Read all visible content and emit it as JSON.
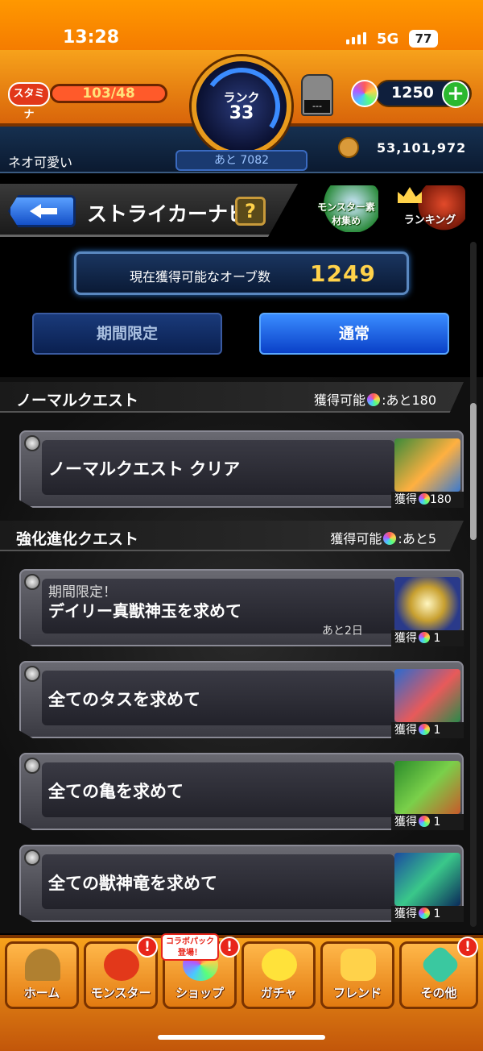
{
  "status_bar": {
    "time": "13:28",
    "network": "5G",
    "battery": "77"
  },
  "header": {
    "stamina_label": "スタミナ",
    "stamina_value": "103/48",
    "rank_label": "ランク",
    "rank_value": "33",
    "rank_remaining": "あと 7082",
    "helmet_value": "---",
    "orb_count": "1250",
    "player_name": "ネオ可愛い",
    "coins": "53,101,972"
  },
  "nav": {
    "title": "ストライカーナビ",
    "help": "?",
    "monster_collect_label": "モンスター素材集め",
    "ranking_label": "ランキング"
  },
  "orb_panel": {
    "label": "現在獲得可能なオーブ数",
    "value": "1249"
  },
  "tabs": {
    "limited": "期間限定",
    "normal": "通常"
  },
  "sections": [
    {
      "name": "ノーマルクエスト",
      "available_prefix": "獲得可能",
      "available_suffix": ":あと180"
    },
    {
      "name": "強化進化クエスト",
      "available_prefix": "獲得可能",
      "available_suffix": ":あと5"
    }
  ],
  "cards": [
    {
      "title": "ノーマルクエスト クリア",
      "reward_label": "獲得",
      "reward_value": "180"
    },
    {
      "sub": "期間限定！",
      "title": "デイリー真獣神玉を求めて",
      "days": "あと2日",
      "reward_label": "獲得",
      "reward_value": "1"
    },
    {
      "title": "全てのタスを求めて",
      "reward_label": "獲得",
      "reward_value": "1"
    },
    {
      "title": "全ての亀を求めて",
      "reward_label": "獲得",
      "reward_value": "1"
    },
    {
      "title": "全ての獣神竜を求めて",
      "reward_label": "獲得",
      "reward_value": "1"
    }
  ],
  "bottom_nav": {
    "home": "ホーム",
    "monster": "モンスター",
    "shop": "ショップ",
    "gacha": "ガチャ",
    "friend": "フレンド",
    "other": "その他",
    "collab_badge": "コラボパック 登場！",
    "alert": "!"
  },
  "colors": {
    "accent_orange": "#f7a21b",
    "orb_gold": "#ffd24a",
    "tab_active": "#3a8cff"
  }
}
